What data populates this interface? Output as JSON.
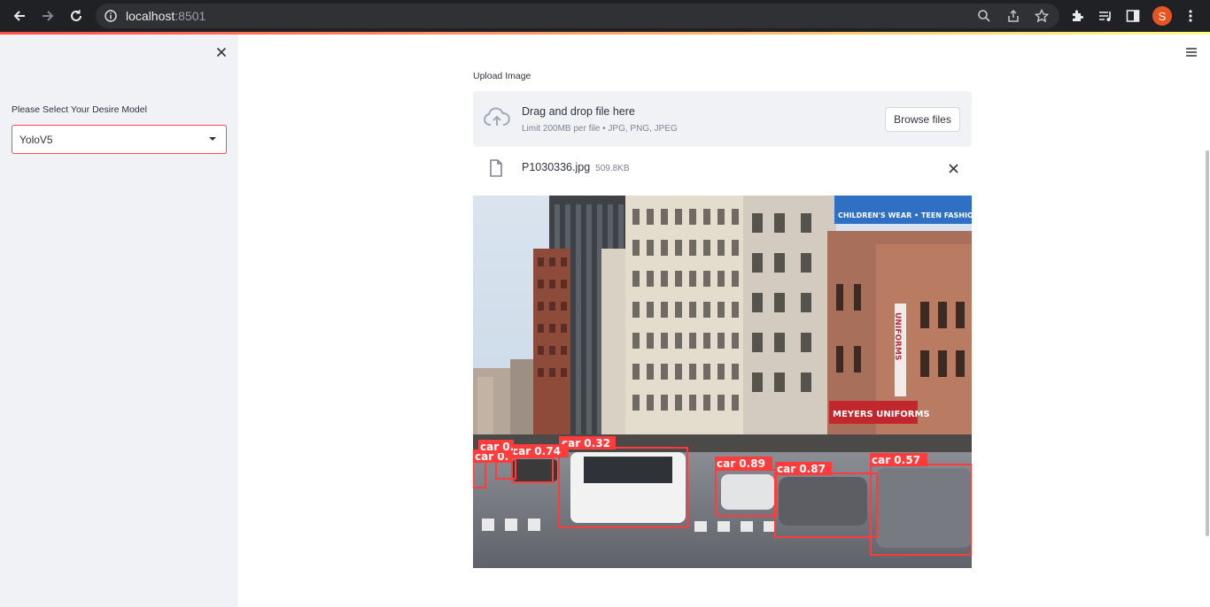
{
  "browser": {
    "url_host": "localhost",
    "url_port": ":8501",
    "profile_initial": "S"
  },
  "sidebar": {
    "select_label": "Please Select Your Desire Model",
    "select_value": "YoloV5"
  },
  "uploader": {
    "label": "Upload Image",
    "drop_title": "Drag and drop file here",
    "drop_limit": "Limit 200MB per file • JPG, PNG, JPEG",
    "browse_label": "Browse files"
  },
  "file": {
    "name": "P1030336.jpg",
    "size": "509.8KB"
  },
  "image": {
    "signs": {
      "top_banner": "CHILDREN'S WEAR • TEEN FASHIONS • S",
      "uniforms_vertical": "UNIFORMS",
      "meyers": "MEYERS UNIFORMS"
    },
    "detections": [
      {
        "label": "car 0.32"
      },
      {
        "label": "car 0.74"
      },
      {
        "label": "car 0."
      },
      {
        "label": "car 0."
      },
      {
        "label": "car 0.89"
      },
      {
        "label": "car 0.87"
      },
      {
        "label": "car 0.57"
      }
    ]
  },
  "colors": {
    "accent": "#ff4b4b",
    "sidebar_bg": "#f0f2f6",
    "text": "#31333f",
    "chrome_bg": "#202124"
  }
}
